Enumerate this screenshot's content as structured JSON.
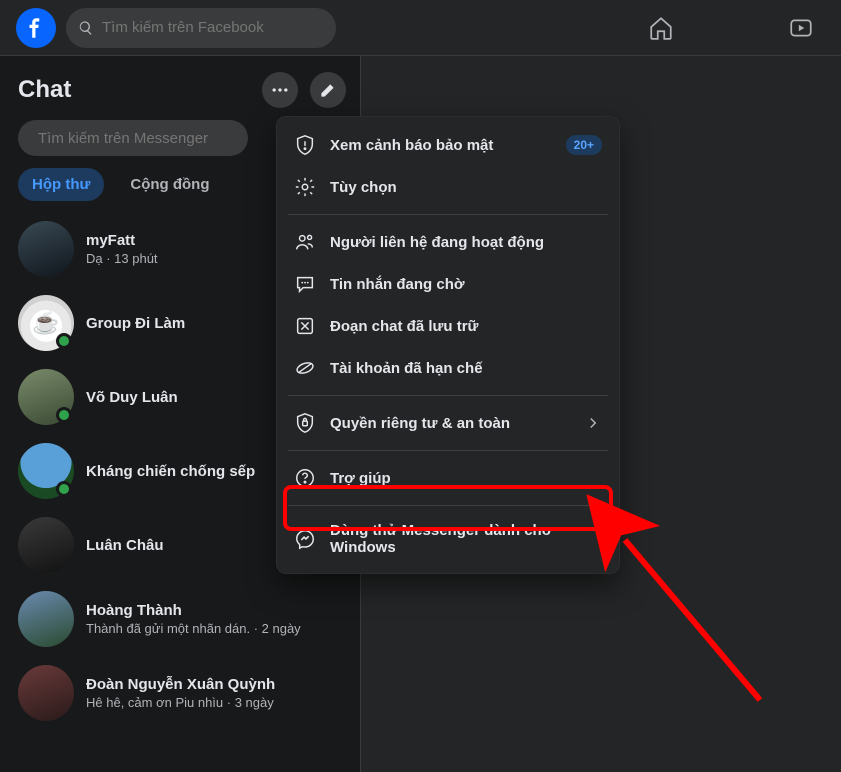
{
  "topbar": {
    "search_placeholder": "Tìm kiếm trên Facebook"
  },
  "sidebar": {
    "title": "Chat",
    "search_placeholder": "Tìm kiếm trên Messenger",
    "tabs": [
      {
        "label": "Hộp thư",
        "active": true
      },
      {
        "label": "Cộng đồng",
        "active": false
      }
    ],
    "chats": [
      {
        "name": "myFatt",
        "subtitle": "Dạ · 13 phút",
        "online": false,
        "avatar": "photo6"
      },
      {
        "name": "Group Đi Làm",
        "subtitle": "",
        "online": true,
        "avatar": "cup"
      },
      {
        "name": "Võ Duy Luân",
        "subtitle": "",
        "online": true,
        "avatar": "photo1"
      },
      {
        "name": "Kháng chiến chống sếp",
        "subtitle": "",
        "online": true,
        "avatar": "photo2"
      },
      {
        "name": "Luân Châu",
        "subtitle": "",
        "online": false,
        "avatar": "photo3"
      },
      {
        "name": "Hoàng Thành",
        "subtitle": "Thành đã gửi một nhãn dán. · 2 ngày",
        "online": false,
        "avatar": "photo4"
      },
      {
        "name": "Đoàn Nguyễn Xuân Quỳnh",
        "subtitle": "Hê hê, cảm ơn Piu nhìu · 3 ngày",
        "online": false,
        "avatar": "photo5"
      }
    ]
  },
  "popup": {
    "items": [
      {
        "icon": "shield-alert-icon",
        "label": "Xem cảnh báo bảo mật",
        "badge": "20+"
      },
      {
        "icon": "gear-icon",
        "label": "Tùy chọn"
      },
      {
        "divider": true
      },
      {
        "icon": "contacts-icon",
        "label": "Người liên hệ đang hoạt động"
      },
      {
        "icon": "chat-waiting-icon",
        "label": "Tin nhắn đang chờ"
      },
      {
        "icon": "archive-icon",
        "label": "Đoạn chat đã lưu trữ"
      },
      {
        "icon": "restricted-icon",
        "label": "Tài khoản đã hạn chế"
      },
      {
        "divider": true
      },
      {
        "icon": "privacy-shield-icon",
        "label": "Quyền riêng tư & an toàn",
        "chevron": true
      },
      {
        "divider": true
      },
      {
        "icon": "help-icon",
        "label": "Trợ giúp"
      },
      {
        "divider": true
      },
      {
        "icon": "messenger-icon",
        "label": "Dùng thử Messenger dành cho Windows"
      }
    ]
  }
}
